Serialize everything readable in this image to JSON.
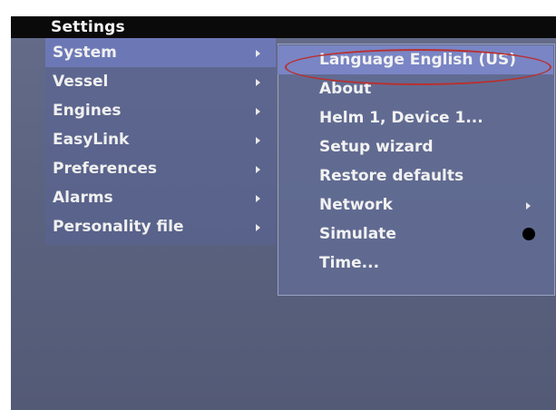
{
  "window": {
    "title": "Settings"
  },
  "main_menu": {
    "items": [
      {
        "label": "System",
        "selected": true
      },
      {
        "label": "Vessel",
        "selected": false
      },
      {
        "label": "Engines",
        "selected": false
      },
      {
        "label": "EasyLink",
        "selected": false
      },
      {
        "label": "Preferences",
        "selected": false
      },
      {
        "label": "Alarms",
        "selected": false
      },
      {
        "label": "Personality file",
        "selected": false
      }
    ]
  },
  "submenu": {
    "items": [
      {
        "label": "Language English (US)",
        "selected": true
      },
      {
        "label": "About"
      },
      {
        "label": "Helm 1, Device 1..."
      },
      {
        "label": "Setup wizard"
      },
      {
        "label": "Restore defaults"
      },
      {
        "label": "Network",
        "has_submenu": true
      },
      {
        "label": "Simulate",
        "toggle_on": true
      },
      {
        "label": "Time..."
      }
    ]
  },
  "icons": {
    "submenu_arrow": "chevron-right-icon",
    "toggle_dot": "filled-circle-icon"
  },
  "colors": {
    "background": "#5b6380",
    "selection": "#6c78b6",
    "annotation": "#b8312f"
  }
}
